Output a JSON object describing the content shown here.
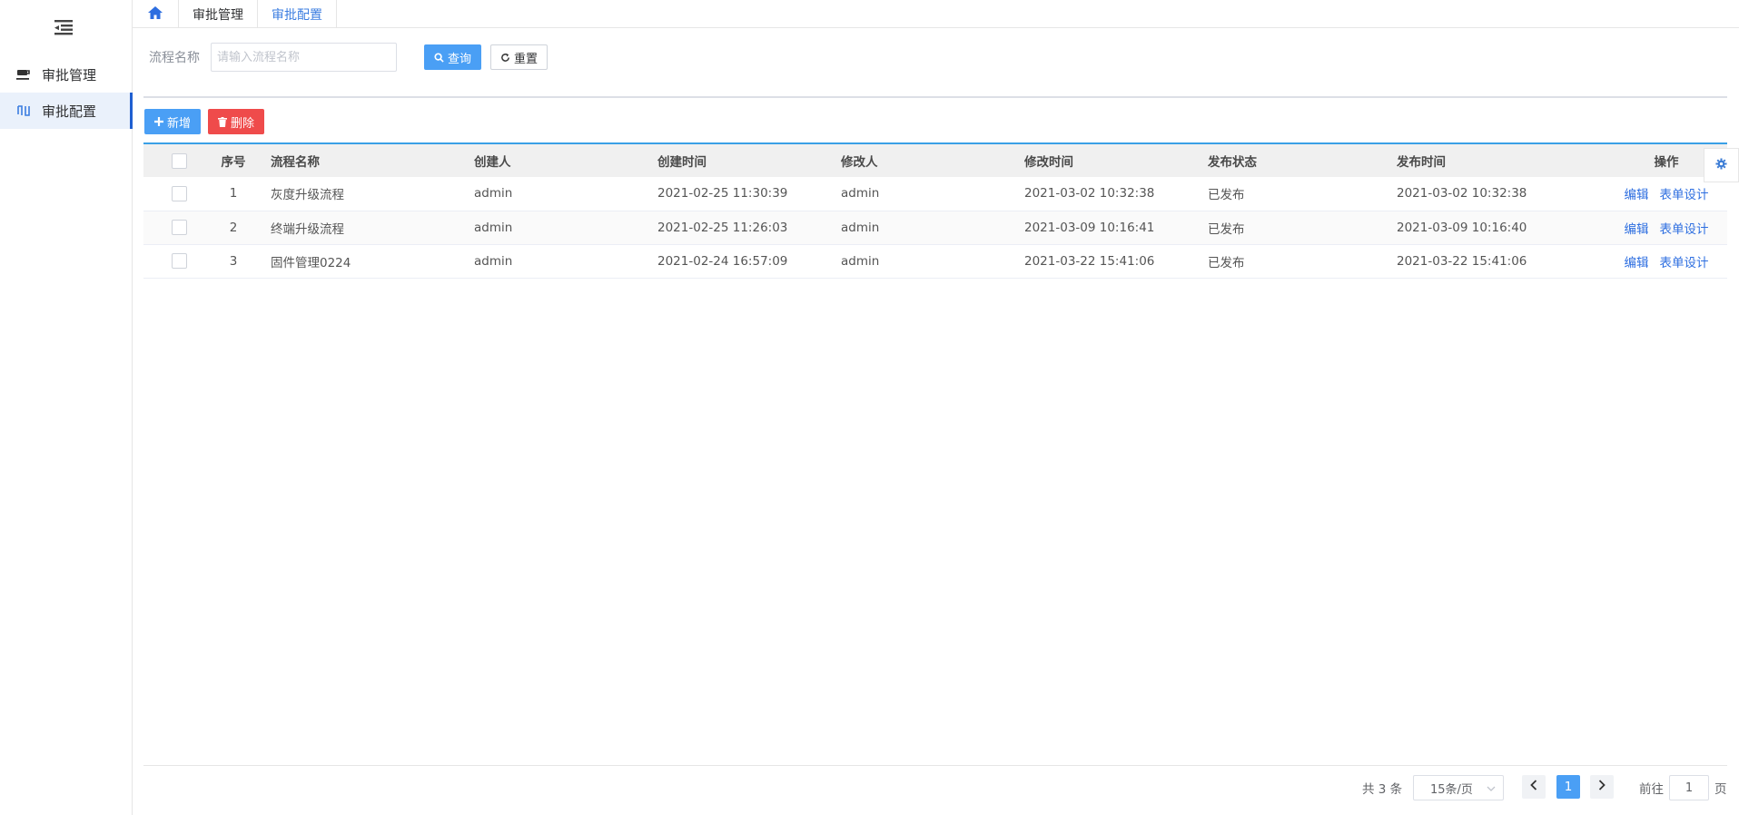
{
  "sidebar": {
    "items": [
      {
        "label": "审批管理",
        "icon": "cup-icon",
        "active": false
      },
      {
        "label": "审批配置",
        "icon": "flow-icon",
        "active": true
      }
    ]
  },
  "tabs": [
    {
      "label": "审批管理",
      "active": false
    },
    {
      "label": "审批配置",
      "active": true
    }
  ],
  "filter": {
    "label": "流程名称",
    "placeholder": "请输入流程名称",
    "value": "",
    "query_label": "查询",
    "reset_label": "重置"
  },
  "toolbar": {
    "add_label": "新增",
    "delete_label": "删除"
  },
  "table": {
    "headers": [
      "序号",
      "流程名称",
      "创建人",
      "创建时间",
      "修改人",
      "修改时间",
      "发布状态",
      "发布时间",
      "操作"
    ],
    "rows": [
      {
        "idx": "1",
        "name": "灰度升级流程",
        "creator": "admin",
        "created": "2021-02-25 11:30:39",
        "modifier": "admin",
        "modified": "2021-03-02 10:32:38",
        "status": "已发布",
        "published": "2021-03-02 10:32:38"
      },
      {
        "idx": "2",
        "name": "终端升级流程",
        "creator": "admin",
        "created": "2021-02-25 11:26:03",
        "modifier": "admin",
        "modified": "2021-03-09 10:16:41",
        "status": "已发布",
        "published": "2021-03-09 10:16:40"
      },
      {
        "idx": "3",
        "name": "固件管理0224",
        "creator": "admin",
        "created": "2021-02-24 16:57:09",
        "modifier": "admin",
        "modified": "2021-03-22 15:41:06",
        "status": "已发布",
        "published": "2021-03-22 15:41:06"
      }
    ],
    "ops": {
      "edit": "编辑",
      "form_design": "表单设计"
    }
  },
  "pagination": {
    "total": "共 3 条",
    "page_size": "15条/页",
    "current_page": "1",
    "goto_label": "前往",
    "goto_value": "1",
    "page_unit": "页"
  },
  "colors": {
    "primary": "#4a9ff5",
    "danger": "#ef4b4b",
    "link": "#2d6ee0",
    "active_nav": "#1f5fd1"
  }
}
